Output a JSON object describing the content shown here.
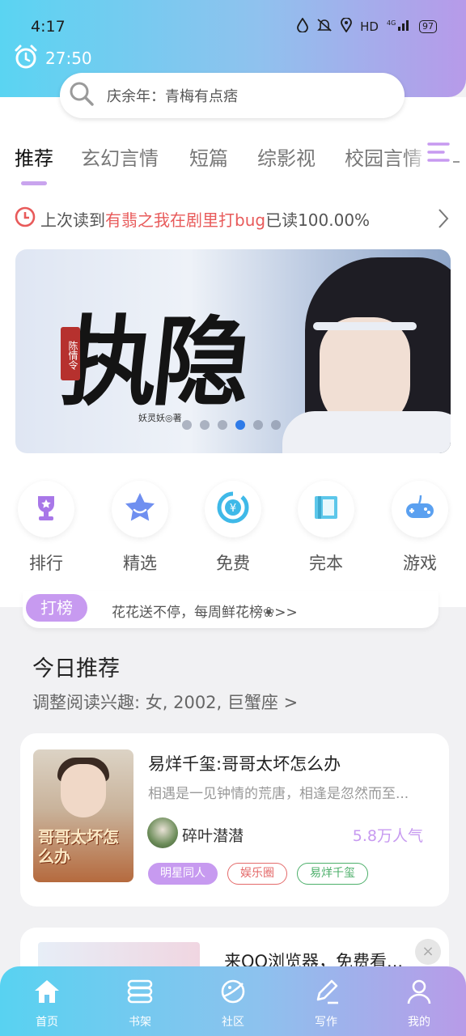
{
  "status_bar": {
    "time": "4:17",
    "network": "HD",
    "signal": "⁴⁶",
    "battery": "97"
  },
  "timer": {
    "value": "27:50"
  },
  "search": {
    "placeholder": "庆余年：青梅有点痞"
  },
  "tabs": [
    "推荐",
    "玄幻言情",
    "短篇",
    "综影视",
    "校园言情"
  ],
  "last_read": {
    "prefix": "上次读到",
    "title": "有翡之我在剧里打bug",
    "suffix": "已读100.00%"
  },
  "banner": {
    "title": "执隐",
    "seal": "陈情令",
    "author": "妖灵妖◎著",
    "active_dot": 3,
    "dot_count": 6
  },
  "entries": [
    {
      "label": "排行",
      "icon": "trophy-icon"
    },
    {
      "label": "精选",
      "icon": "star-icon"
    },
    {
      "label": "免费",
      "icon": "free-yen-icon"
    },
    {
      "label": "完本",
      "icon": "book-icon"
    },
    {
      "label": "游戏",
      "icon": "gamepad-icon"
    }
  ],
  "promo": {
    "badge": "打榜",
    "text": "花花送不停，每周鲜花榜❀>>"
  },
  "recommend": {
    "title": "今日推荐",
    "subtitle": "调整阅读兴趣: 女, 2002, 巨蟹座 >",
    "book": {
      "title": "易烊千玺:哥哥太坏怎么办",
      "description": "相遇是一见钟情的荒唐，相逢是忽然而至...",
      "author": "碎叶潜潜",
      "popularity": "5.8万人气",
      "cover_text": "哥哥太坏怎么办",
      "tags": [
        "明星同人",
        "娱乐圈",
        "易烊千玺"
      ]
    }
  },
  "ad": {
    "title": "来QQ浏览器，免费看...",
    "close": "×"
  },
  "bottom_nav": [
    "首页",
    "书架",
    "社区",
    "写作",
    "我的"
  ],
  "colors": {
    "accent": "#c79af0",
    "header_start": "#5ad4f2",
    "header_end": "#b79ae9",
    "highlight": "#e85a5a"
  }
}
